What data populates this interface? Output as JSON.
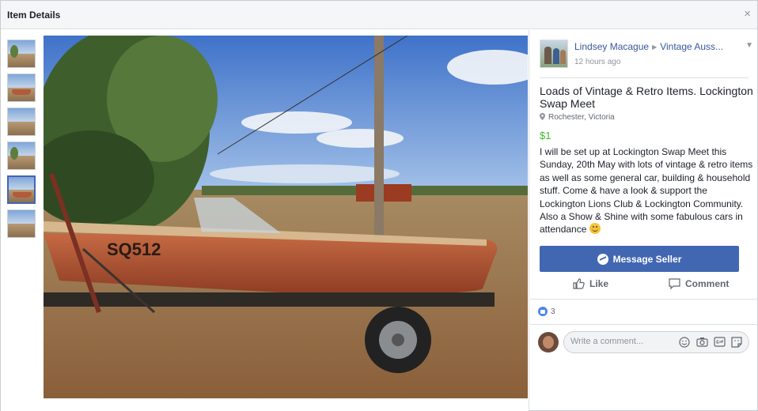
{
  "dialog": {
    "title": "Item Details",
    "close": "×"
  },
  "post": {
    "poster_name": "Lindsey Macague",
    "group_name": "Vintage Auss...",
    "time": "12 hours ago",
    "title": "Loads of Vintage & Retro Items. Lockington Swap Meet",
    "location": "Rochester, Victoria",
    "price": "$1",
    "description": "I will be set up at Lockington Swap Meet this Sunday, 20th May with lots of vintage & retro items as well as some general car, building & household stuff. Come & have a look & support the Lockington Lions Club & Lockington Community. Also a Show & Shine with some fabulous cars in attendance",
    "message_button": "Message Seller",
    "like_label": "Like",
    "comment_label": "Comment",
    "reaction_count": "3",
    "comment_placeholder": "Write a comment..."
  },
  "photo": {
    "boat_registration": "SQ512",
    "thumbnail_count": 6,
    "active_thumbnail": 5
  },
  "icons": {
    "close": "close-icon",
    "chevron": "chevron-down-icon",
    "pin": "location-pin-icon",
    "messenger": "messenger-icon",
    "like": "thumbs-up-icon",
    "comment": "comment-bubble-icon",
    "emoji": "emoji-icon",
    "camera": "camera-icon",
    "gif": "gif-icon",
    "sticker": "sticker-icon"
  },
  "colors": {
    "brand": "#4267b2",
    "link": "#385898",
    "price": "#42b72a",
    "muted": "#90949c"
  }
}
